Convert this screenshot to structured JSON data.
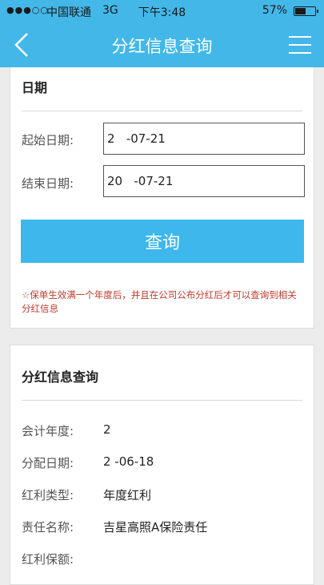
{
  "status_bar": {
    "signal": "●●●○○",
    "carrier": "中国联通",
    "network": "3G",
    "time": "下午3:48",
    "battery_text": "57%",
    "battery_level": 0.57
  },
  "nav": {
    "title": "分红信息查询",
    "back_icon": "chevron-left-icon",
    "menu_icon": "hamburger-menu-icon"
  },
  "date_section": {
    "title": "日期",
    "start_label": "起始日期:",
    "start_value": "2   -07-21",
    "end_label": "结束日期:",
    "end_value": "20   -07-21",
    "query_button": "查询",
    "notice": "☆保单生效满一个年度后，并且在公司公布分红后才可以查询到相关分红信息"
  },
  "result_section": {
    "title": "分红信息查询",
    "rows": [
      {
        "label": "会计年度:",
        "value": "2"
      },
      {
        "label": "分配日期:",
        "value": "2   -06-18"
      },
      {
        "label": "红利类型:",
        "value": "年度红利"
      },
      {
        "label": "责任名称:",
        "value": "吉星高照A保险责任"
      },
      {
        "label": "红利保额:",
        "value": ""
      }
    ]
  },
  "colors": {
    "accent": "#43b8e8",
    "button": "#3db7ec",
    "notice": "#c0392b"
  }
}
